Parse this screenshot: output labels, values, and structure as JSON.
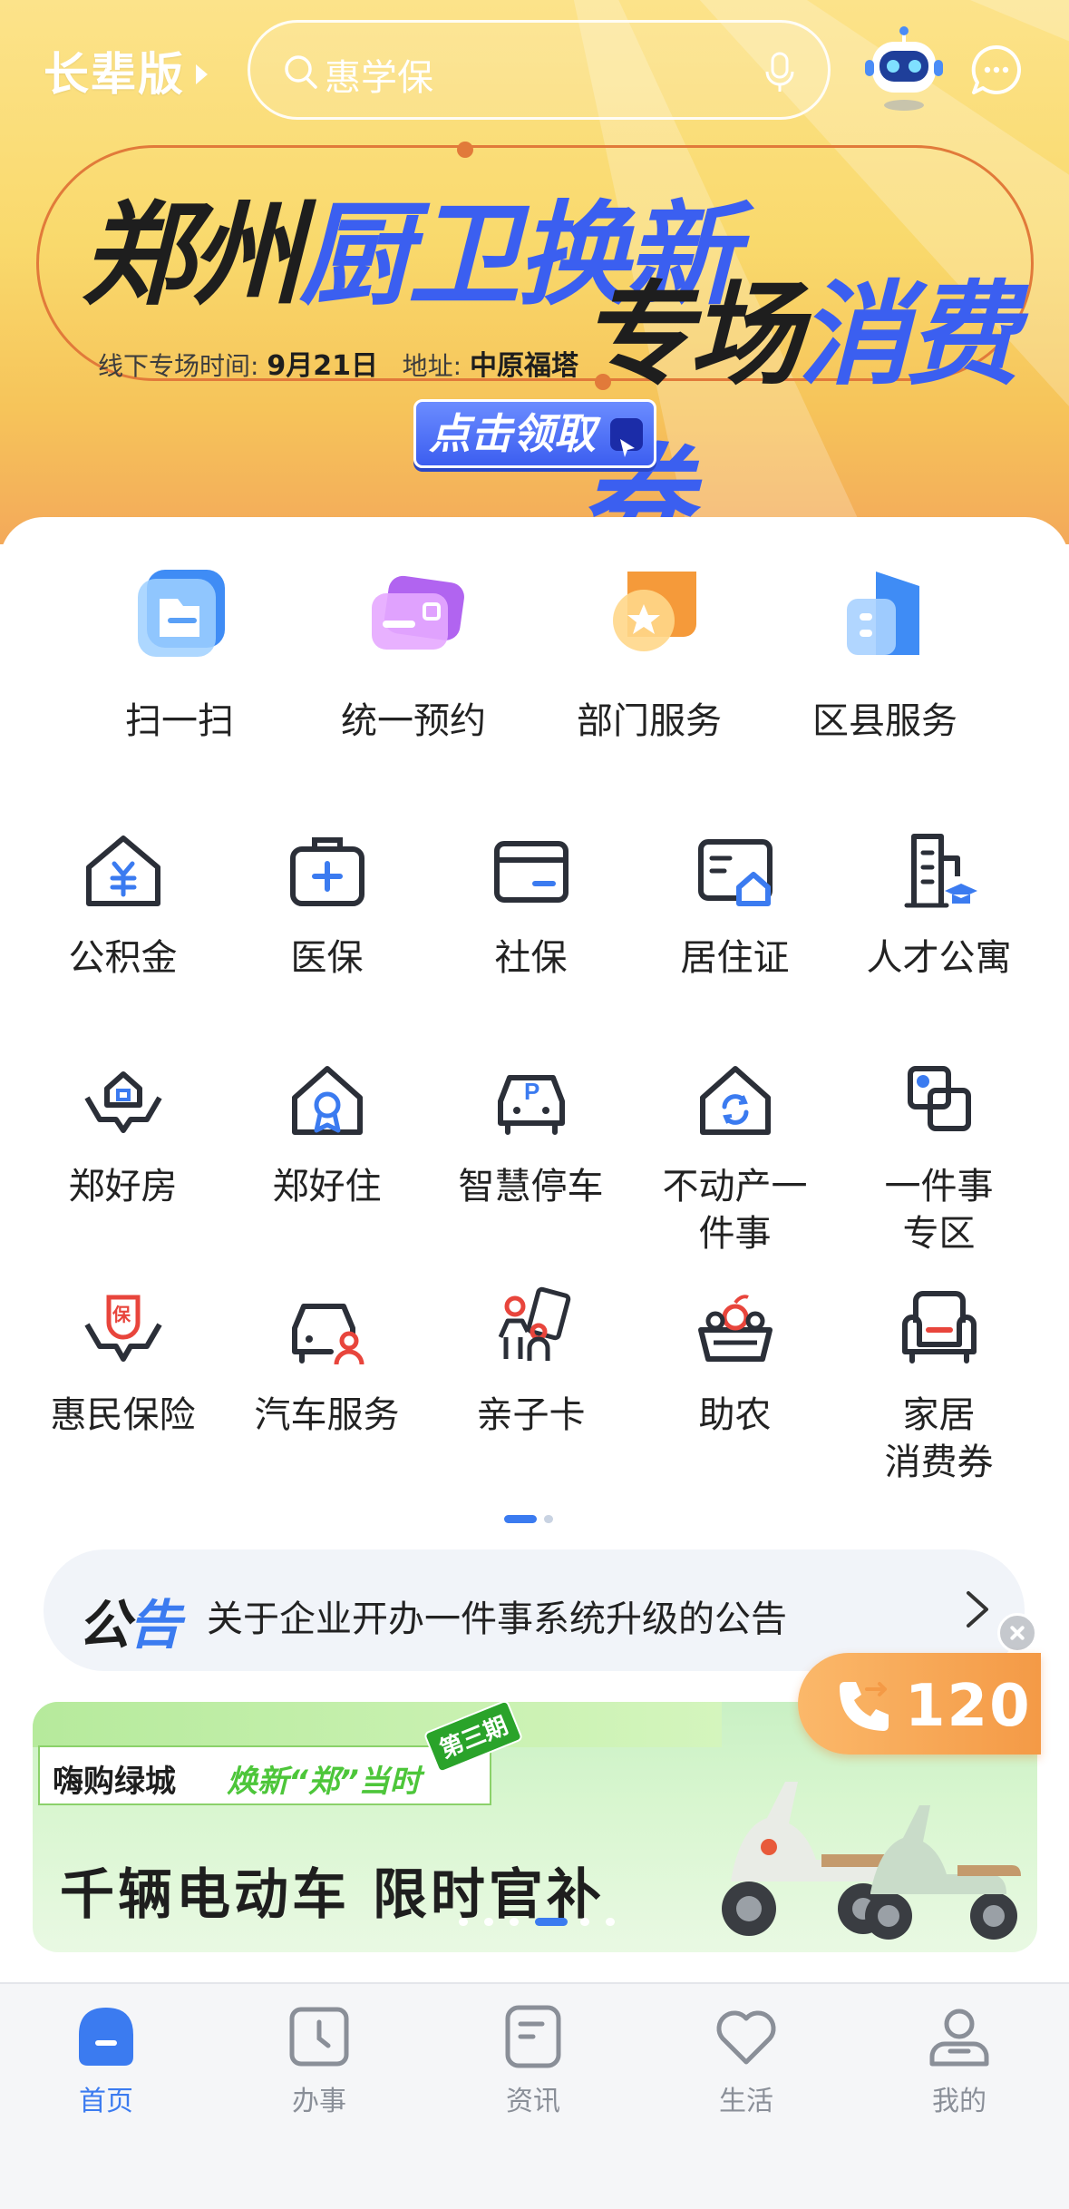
{
  "header": {
    "elder_mode_label": "长辈版",
    "search_placeholder": "惠学保"
  },
  "banner": {
    "title_part1_dark": "郑州",
    "title_part1_blue": "厨卫换新",
    "title_part2_dark": "专场",
    "title_part2_blue": "消费券",
    "info_time_label": "线下专场时间:",
    "info_time_value": "9月21日",
    "info_addr_label": "地址:",
    "info_addr_value": "中原福塔",
    "cta_label": "点击领取"
  },
  "quick_services": [
    {
      "label": "扫一扫",
      "icon": "scan-icon"
    },
    {
      "label": "统一预约",
      "icon": "appointment-card-icon"
    },
    {
      "label": "部门服务",
      "icon": "department-star-icon"
    },
    {
      "label": "区县服务",
      "icon": "district-building-icon"
    }
  ],
  "service_grid": [
    {
      "label": "公积金",
      "icon": "housing-fund-icon"
    },
    {
      "label": "医保",
      "icon": "medical-insurance-icon"
    },
    {
      "label": "社保",
      "icon": "social-security-card-icon"
    },
    {
      "label": "居住证",
      "icon": "residence-permit-icon"
    },
    {
      "label": "人才公寓",
      "icon": "talent-apartment-icon"
    },
    {
      "label": "郑好房",
      "icon": "hands-house-icon"
    },
    {
      "label": "郑好住",
      "icon": "house-medal-icon"
    },
    {
      "label": "智慧停车",
      "icon": "parking-car-icon"
    },
    {
      "label": "不动产一件事",
      "line1": "不动产一",
      "line2": "件事",
      "icon": "house-refresh-icon"
    },
    {
      "label": "一件事专区",
      "line1": "一件事",
      "line2": "专区",
      "icon": "overlap-squares-icon"
    },
    {
      "label": "惠民保险",
      "icon": "insurance-hands-icon"
    },
    {
      "label": "汽车服务",
      "icon": "car-person-icon"
    },
    {
      "label": "亲子卡",
      "icon": "family-card-icon"
    },
    {
      "label": "助农",
      "icon": "produce-basket-icon"
    },
    {
      "label": "家居消费券",
      "line1": "家居",
      "line2": "消费券",
      "icon": "armchair-icon"
    }
  ],
  "grid_pager": {
    "pages": 2,
    "current": 1
  },
  "notice": {
    "tag_part1": "公",
    "tag_part2": "告",
    "text": "关于企业开办一件事系统升级的公告"
  },
  "emergency": {
    "number": "120"
  },
  "promo": {
    "tag1": "嗨购绿城",
    "tag2": "焕新“郑”当时",
    "badge": "第三期",
    "title": "千辆电动车  限时官补",
    "slides": 6,
    "current_slide": 4
  },
  "tabs": [
    {
      "label": "首页",
      "icon": "home-icon",
      "active": true
    },
    {
      "label": "办事",
      "icon": "clock-icon",
      "active": false
    },
    {
      "label": "资讯",
      "icon": "news-doc-icon",
      "active": false
    },
    {
      "label": "生活",
      "icon": "heart-icon",
      "active": false
    },
    {
      "label": "我的",
      "icon": "user-icon",
      "active": false
    }
  ],
  "colors": {
    "accent": "#3b7bf0",
    "banner_blue": "#3b5ff0",
    "emergency_orange": "#f49a46",
    "promo_green": "#4dc63a"
  }
}
